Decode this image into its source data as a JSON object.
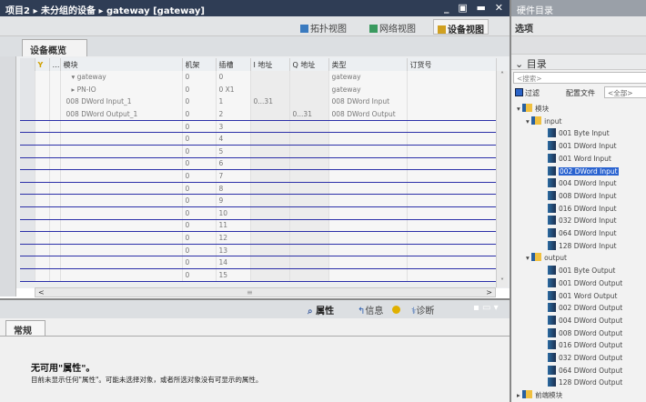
{
  "title": {
    "breadcrumb": [
      "项目2",
      "未分组的设备",
      "gateway [gateway]"
    ],
    "separator": "▸"
  },
  "views": {
    "topology": "拓扑视图",
    "network": "网络视图",
    "device": "设备视图",
    "active": "device"
  },
  "overview_tab": "设备概览",
  "table": {
    "columns": [
      "",
      "",
      "模块",
      "机架",
      "插槽",
      "I 地址",
      "Q 地址",
      "类型",
      "订货号"
    ],
    "rows": [
      {
        "module": "▾ gateway",
        "rack": "0",
        "slot": "0",
        "i": "",
        "q": "",
        "type": "gateway",
        "order": ""
      },
      {
        "module": "▸ PN-IO",
        "rack": "0",
        "slot": "0 X1",
        "i": "",
        "q": "",
        "type": "gateway",
        "order": ""
      },
      {
        "module": "008 DWord Input_1",
        "rack": "0",
        "slot": "1",
        "i": "0...31",
        "q": "",
        "type": "008 DWord Input",
        "order": ""
      },
      {
        "module": "008 DWord Output_1",
        "rack": "0",
        "slot": "2",
        "i": "",
        "q": "0...31",
        "type": "008 DWord Output",
        "order": ""
      },
      {
        "module": "",
        "rack": "0",
        "slot": "3"
      },
      {
        "module": "",
        "rack": "0",
        "slot": "4"
      },
      {
        "module": "",
        "rack": "0",
        "slot": "5"
      },
      {
        "module": "",
        "rack": "0",
        "slot": "6"
      },
      {
        "module": "",
        "rack": "0",
        "slot": "7"
      },
      {
        "module": "",
        "rack": "0",
        "slot": "8"
      },
      {
        "module": "",
        "rack": "0",
        "slot": "9"
      },
      {
        "module": "",
        "rack": "0",
        "slot": "10"
      },
      {
        "module": "",
        "rack": "0",
        "slot": "11"
      },
      {
        "module": "",
        "rack": "0",
        "slot": "12"
      },
      {
        "module": "",
        "rack": "0",
        "slot": "13"
      },
      {
        "module": "",
        "rack": "0",
        "slot": "14"
      },
      {
        "module": "",
        "rack": "0",
        "slot": "15"
      }
    ]
  },
  "lower": {
    "tabs": {
      "properties": "属性",
      "info": "信息",
      "diagnostics": "诊断"
    },
    "general_tab": "常规",
    "message_title": "无可用\"属性\"。",
    "message_body": "目前未显示任何\"属性\"。可能未选择对象，或者所选对象没有可显示的属性。"
  },
  "catalog": {
    "header": "硬件目录",
    "options": "选项",
    "catalog_label": "目录",
    "search_placeholder": "<搜索>",
    "filter_label": "过滤",
    "profile_label": "配置文件",
    "profile_value": "<全部>",
    "tree": {
      "root": "模块",
      "input_folder": "input",
      "inputs": [
        "001 Byte Input",
        "001 DWord Input",
        "001 Word Input",
        "002 DWord Input",
        "004 DWord Input",
        "008 DWord Input",
        "016 DWord Input",
        "032 DWord Input",
        "064 DWord Input",
        "128 DWord Input"
      ],
      "selected": "002 DWord Input",
      "output_folder": "output",
      "outputs": [
        "001 Byte Output",
        "001 DWord Output",
        "001 Word Output",
        "002 DWord Output",
        "004 DWord Output",
        "008 DWord Output",
        "016 DWord Output",
        "032 DWord Output",
        "064 DWord Output",
        "128 DWord Output"
      ],
      "next_folder": "前端模块"
    }
  },
  "colors": {
    "title_bar": "#2f3d55",
    "selection": "#2a63d0",
    "row_separator": "#2b2fa8"
  }
}
